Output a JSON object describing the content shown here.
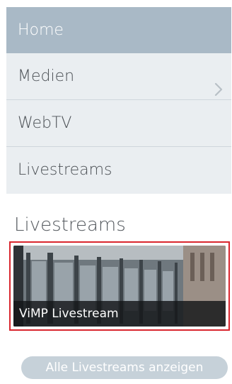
{
  "nav": {
    "items": [
      {
        "label": "Home",
        "active": true
      },
      {
        "label": "Medien",
        "has_submenu": true,
        "icon": "chevron-right-icon"
      },
      {
        "label": "WebTV"
      },
      {
        "label": "Livestreams"
      }
    ]
  },
  "livestreams": {
    "section_title": "Livestreams",
    "card": {
      "caption": "ViMP Livestream"
    },
    "show_all_label": "Alle Livestreams anzeigen"
  },
  "colors": {
    "active_bg": "#a9b9c6",
    "item_bg": "#eaeef1",
    "highlight_border": "#d9262e",
    "button_bg": "#c6d1d9"
  }
}
